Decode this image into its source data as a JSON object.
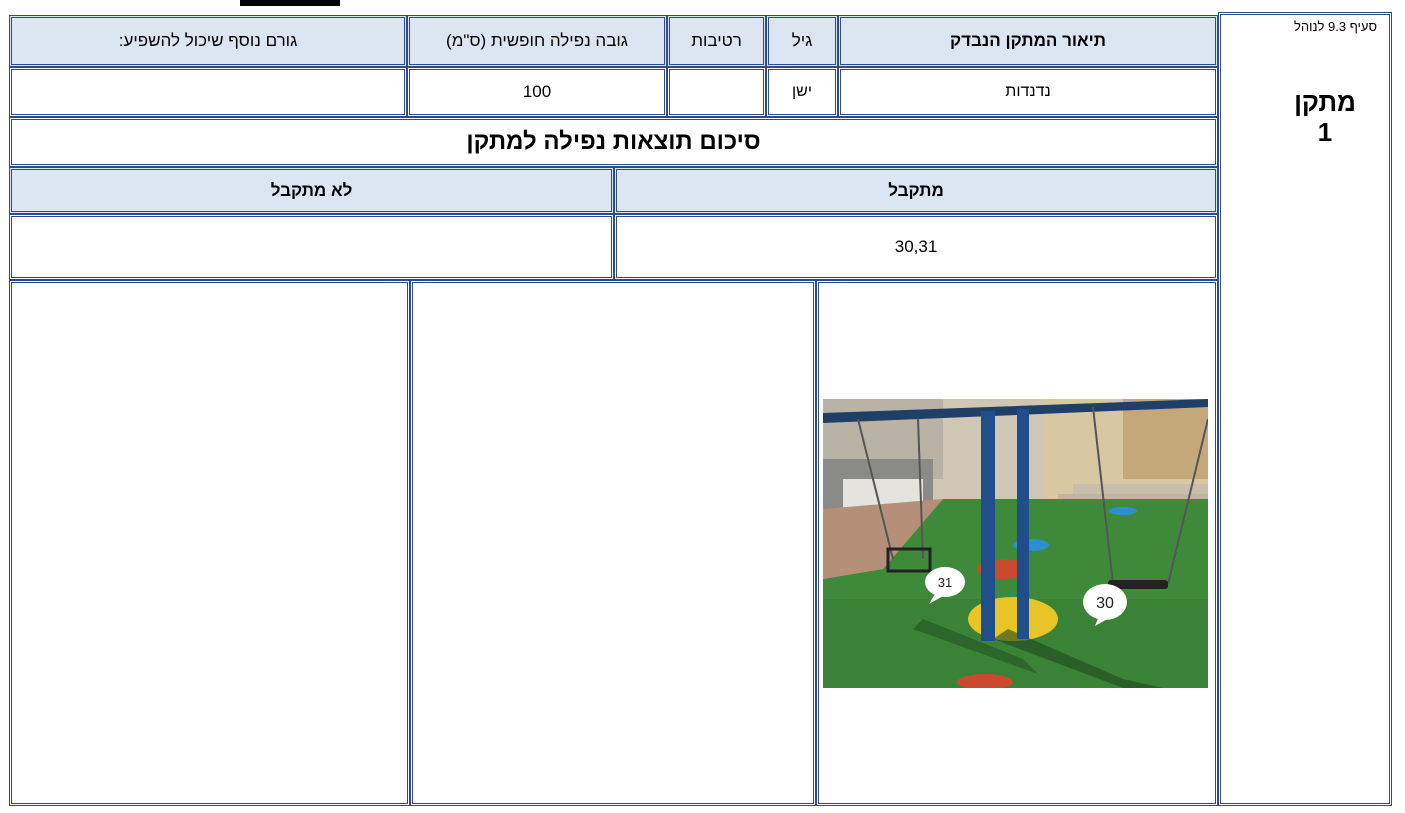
{
  "section_label": "סעיף 9.3 לנוהל",
  "item": {
    "title": "מתקן",
    "number": "1"
  },
  "header": {
    "description": "תיאור המתקן הנבדק",
    "age": "גיל",
    "moisture": "רטיבות",
    "fall_height": "גובה נפילה חופשית (ס\"מ)",
    "extra_factor": "גורם נוסף שיכול להשפיע:"
  },
  "row": {
    "description": "נדנדות",
    "age": "ישן",
    "moisture": "",
    "fall_height": "100",
    "extra_factor": ""
  },
  "summary_title": "סיכום תוצאות נפילה למתקן",
  "results": {
    "accepted_label": "מתקבל",
    "rejected_label": "לא מתקבל",
    "accepted_value": "30,31",
    "rejected_value": ""
  },
  "photo": {
    "labels": [
      "31",
      "30"
    ]
  },
  "colors": {
    "border": "#2e4a8a",
    "header_fill": "#dce6f2"
  }
}
